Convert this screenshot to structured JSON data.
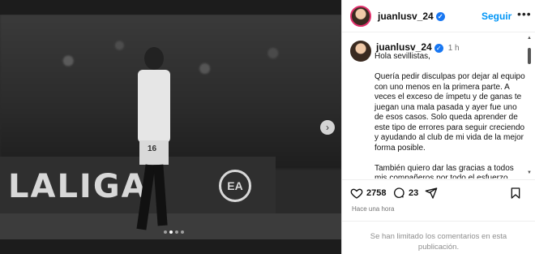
{
  "post": {
    "username": "juanlusv_24",
    "follow_label": "Seguir",
    "more_label": "•••",
    "time_ago": "1 h",
    "caption": "Hola sevillistas,\n\nQuería pedir disculpas por dejar al equipo con uno menos en la primera parte. A veces el exceso de ímpetu y de ganas te juegan una mala pasada y ayer fue uno de esos casos. Solo queda aprender de este tipo de errores para seguir creciendo y ayudando al club de mi vida de la mejor forma posible.\n\nTambién quiero dar las gracias a todos mis compañeros por todo el esfuerzo",
    "likes": "2758",
    "comments": "23",
    "posted_when": "Hace una hora",
    "comments_disabled": "Se han limitado los comentarios en esta publicación."
  },
  "media": {
    "board_text": "LALIGA",
    "board_logo": "EA",
    "shirt_number": "16",
    "next_glyph": "›",
    "carousel_total": 4,
    "carousel_active": 2
  },
  "icons": [
    "verified-badge-icon",
    "heart-icon",
    "comment-icon",
    "share-icon",
    "bookmark-icon",
    "chevron-right-icon"
  ],
  "colors": {
    "follow": "#0095f6",
    "verified": "#1877f2"
  }
}
